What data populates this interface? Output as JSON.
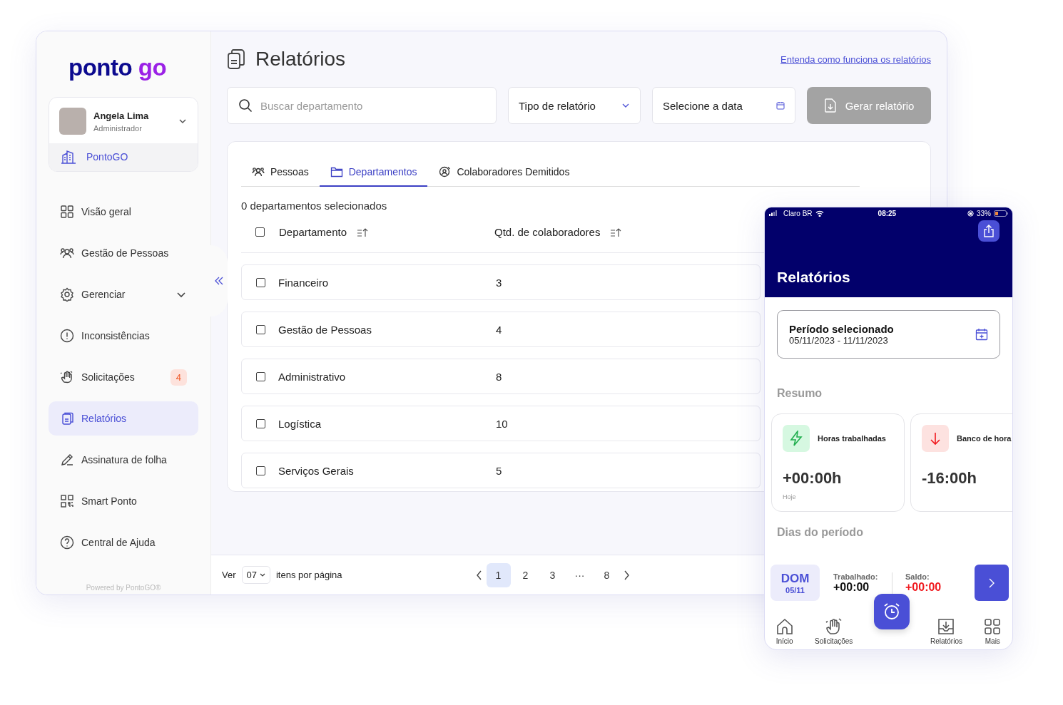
{
  "sidebar": {
    "logo": {
      "text": "ponto",
      "accent": "go"
    },
    "user": {
      "name": "Angela Lima",
      "role": "Administrador",
      "company": "PontoGO"
    },
    "nav": [
      {
        "label": "Visão geral",
        "selected": false
      },
      {
        "label": "Gestão de Pessoas",
        "selected": false
      },
      {
        "label": "Gerenciar",
        "selected": false,
        "expanded": false
      },
      {
        "label": "Inconsistências",
        "selected": false
      },
      {
        "label": "Solicitações",
        "selected": false,
        "badge": "4"
      },
      {
        "label": "Relatórios",
        "selected": true
      },
      {
        "label": "Assinatura de folha",
        "selected": false
      },
      {
        "label": "Smart Ponto",
        "selected": false
      },
      {
        "label": "Central de Ajuda",
        "selected": false
      }
    ],
    "footer": "Powered by PontoGO®"
  },
  "header": {
    "title": "Relatórios",
    "help_link": "Entenda como funciona os relatórios"
  },
  "filters": {
    "search_placeholder": "Buscar departamento",
    "report_type": "Tipo de relatório",
    "date": "Selecione a data",
    "generate_button": {
      "label": "Gerar relatório",
      "disabled": true
    }
  },
  "tabs": [
    {
      "label": "Pessoas",
      "selected": false
    },
    {
      "label": "Departamentos",
      "selected": true
    },
    {
      "label": "Colaboradores Demitidos",
      "selected": false
    }
  ],
  "selection_count": "0 departamentos selecionados",
  "table": {
    "header_checked": false,
    "columns": [
      "Departamento",
      "Qtd. de colaboradores"
    ],
    "rows": [
      {
        "department": "Financeiro",
        "count": "3",
        "checked": false
      },
      {
        "department": "Gestão de Pessoas",
        "count": "4",
        "checked": false
      },
      {
        "department": "Administrativo",
        "count": "8",
        "checked": false
      },
      {
        "department": "Logística",
        "count": "10",
        "checked": false
      },
      {
        "department": "Serviços Gerais",
        "count": "5",
        "checked": false
      }
    ]
  },
  "pagination": {
    "label_before": "Ver",
    "per_page": "07",
    "label_after": "itens por página",
    "pages": [
      {
        "label": "1",
        "selected": true
      },
      {
        "label": "2",
        "selected": false
      },
      {
        "label": "3",
        "selected": false
      },
      {
        "label": "···",
        "selected": false
      },
      {
        "label": "8",
        "selected": false
      }
    ]
  },
  "phone": {
    "status": {
      "carrier": "Claro BR",
      "time": "08:25",
      "battery": "33%"
    },
    "title": "Relatórios",
    "period": {
      "label": "Período selecionado",
      "range": "05/11/2023 - 11/11/2023"
    },
    "summary_title": "Resumo",
    "summary_cards": [
      {
        "kind": "up",
        "title": "Horas trabalhadas",
        "value": "+00:00h",
        "note": "Hoje"
      },
      {
        "kind": "down",
        "title": "Banco de hora",
        "value": "-16:00h"
      }
    ],
    "days_title": "Dias do período",
    "day": {
      "weekday": "DOM",
      "date": "05/11",
      "worked_label": "Trabalhado:",
      "worked": "+00:00",
      "balance_label": "Saldo:",
      "balance": "+00:00"
    },
    "tabbar": [
      {
        "label": "Início"
      },
      {
        "label": "Solicitações"
      },
      {
        "label": "Relatórios"
      },
      {
        "label": "Mais"
      }
    ]
  }
}
